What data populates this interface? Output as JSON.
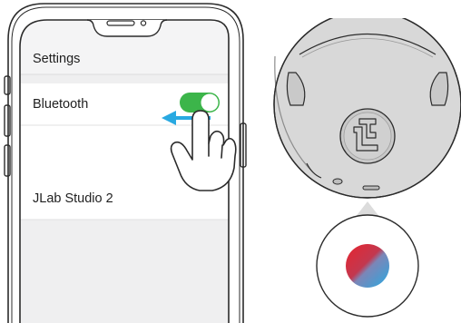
{
  "phone": {
    "header_title": "Settings",
    "bluetooth_label": "Bluetooth",
    "bluetooth_toggle": {
      "state": "on",
      "color": "#3cb54a"
    },
    "device_name": "JLab Studio 2",
    "arrow_color": "#29a9e1"
  },
  "headphone": {
    "led_colors": [
      "#e8242e",
      "#29a9e1"
    ]
  },
  "icons": [
    "hand-pointer-icon",
    "swipe-left-arrow-icon",
    "jlab-logo-icon",
    "toggle-switch-icon"
  ]
}
